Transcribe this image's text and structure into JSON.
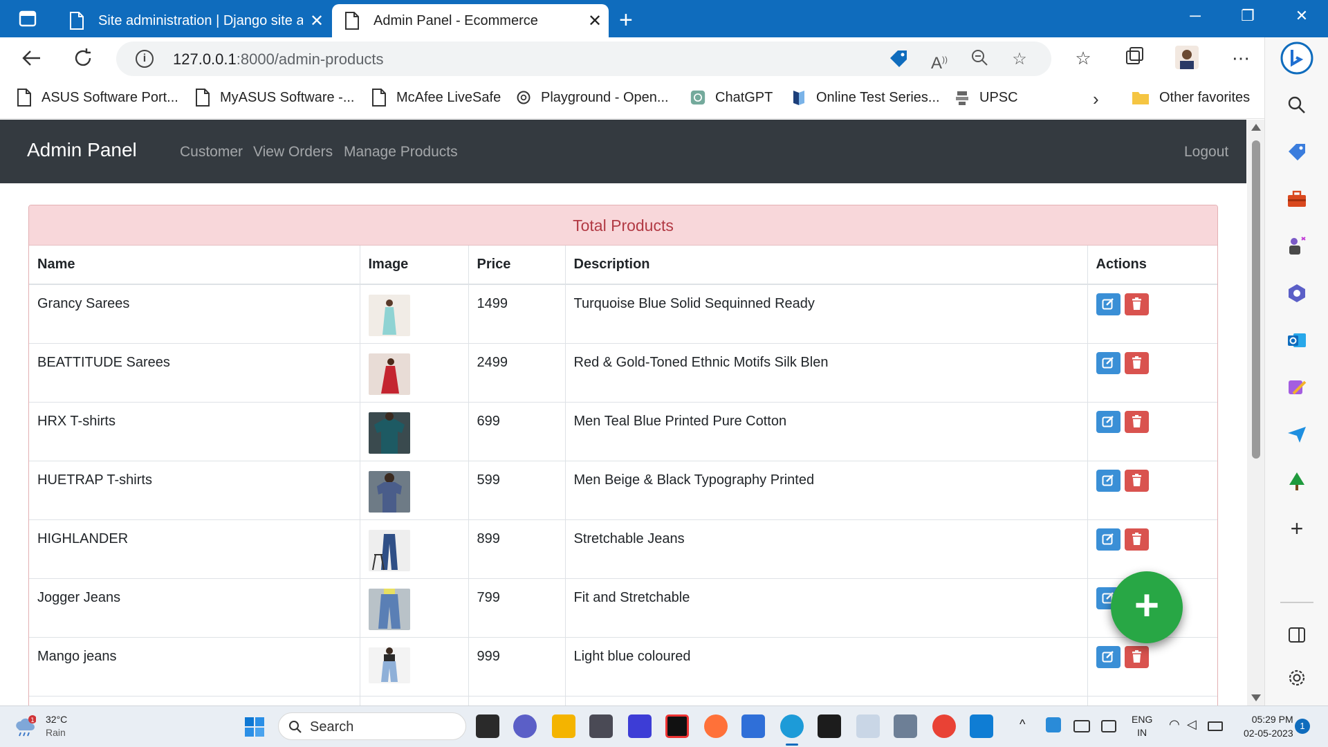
{
  "browser": {
    "tabs": [
      {
        "label": "Site administration | Django site admin"
      },
      {
        "label": "Admin Panel - Ecommerce"
      }
    ],
    "address": {
      "host": "127.0.0.1",
      "path": ":8000/admin-products"
    },
    "favorites": [
      {
        "label": "ASUS Software Port..."
      },
      {
        "label": "MyASUS Software -..."
      },
      {
        "label": "McAfee LiveSafe"
      },
      {
        "label": "Playground - Open..."
      },
      {
        "label": "ChatGPT"
      },
      {
        "label": "Online Test Series..."
      },
      {
        "label": "UPSC"
      }
    ],
    "other_favorites": "Other favorites",
    "accent": "#0f6cbd"
  },
  "page": {
    "navbar": {
      "brand": "Admin Panel",
      "links": [
        "Customer",
        "View Orders",
        "Manage Products"
      ],
      "logout": "Logout",
      "bg": "#343a40"
    },
    "card": {
      "title": "Total Products",
      "header_bg": "#f8d7da",
      "header_color": "#b23a44"
    },
    "table": {
      "headers": [
        "Name",
        "Image",
        "Price",
        "Description",
        "Actions"
      ],
      "rows": [
        {
          "name": "Grancy Sarees",
          "price": "1499",
          "description": "Turquoise Blue Solid Sequinned Ready"
        },
        {
          "name": "BEATTITUDE Sarees",
          "price": "2499",
          "description": "Red & Gold-Toned Ethnic Motifs Silk Blen"
        },
        {
          "name": "HRX T-shirts",
          "price": "699",
          "description": "Men Teal Blue Printed Pure Cotton"
        },
        {
          "name": "HUETRAP T-shirts",
          "price": "599",
          "description": "Men Beige & Black Typography Printed"
        },
        {
          "name": "HIGHLANDER",
          "price": "899",
          "description": "Stretchable Jeans"
        },
        {
          "name": "Jogger Jeans",
          "price": "799",
          "description": "Fit and Stretchable"
        },
        {
          "name": "Mango jeans",
          "price": "999",
          "description": "Light blue coloured"
        }
      ]
    },
    "fab": {
      "symbol": "+",
      "color": "#28a745"
    }
  },
  "taskbar": {
    "weather": {
      "temp": "32°C",
      "condition": "Rain",
      "badge": "1"
    },
    "search_placeholder": "Search",
    "lang": {
      "line1": "ENG",
      "line2": "IN"
    },
    "clock": {
      "time": "05:29 PM",
      "date": "02-05-2023"
    },
    "notifications": "1"
  }
}
